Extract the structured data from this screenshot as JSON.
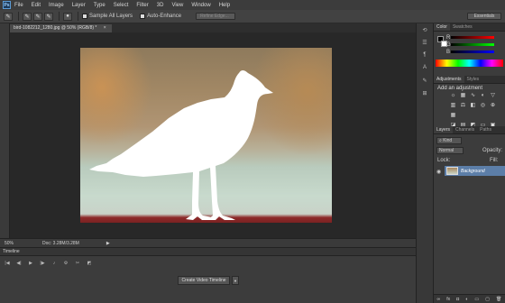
{
  "app": {
    "logo": "Ps"
  },
  "menu": [
    "File",
    "Edit",
    "Image",
    "Layer",
    "Type",
    "Select",
    "Filter",
    "3D",
    "View",
    "Window",
    "Help"
  ],
  "options_bar": {
    "sample_all_layers": "Sample All Layers",
    "auto_enhance": "Auto-Enhance",
    "refine_edge": "Refine Edge...",
    "workspace": "Essentials"
  },
  "document": {
    "tab_title": "bird-1082212_1280.jpg @ 50% (RGB/8) *",
    "zoom": "50%",
    "doc_info": "Doc: 3.28M/3.28M"
  },
  "timeline": {
    "title": "Timeline",
    "create_button": "Create Video Timeline"
  },
  "panels": {
    "color_tabs": [
      "Color",
      "Swatches"
    ],
    "color_channels": [
      "R",
      "G",
      "B"
    ],
    "adjustments_tabs": [
      "Adjustments",
      "Styles"
    ],
    "adjustments_heading": "Add an adjustment",
    "layers_tabs": [
      "Layers",
      "Channels",
      "Paths"
    ],
    "kind_filter": "Kind",
    "blend_mode": "Normal",
    "opacity_label": "Opacity:",
    "lock_label": "Lock:",
    "fill_label": "Fill:",
    "layer_name": "Background"
  },
  "colors": {
    "accent": "#5c7ea8",
    "foreground": "#000000",
    "background": "#ffffff"
  }
}
